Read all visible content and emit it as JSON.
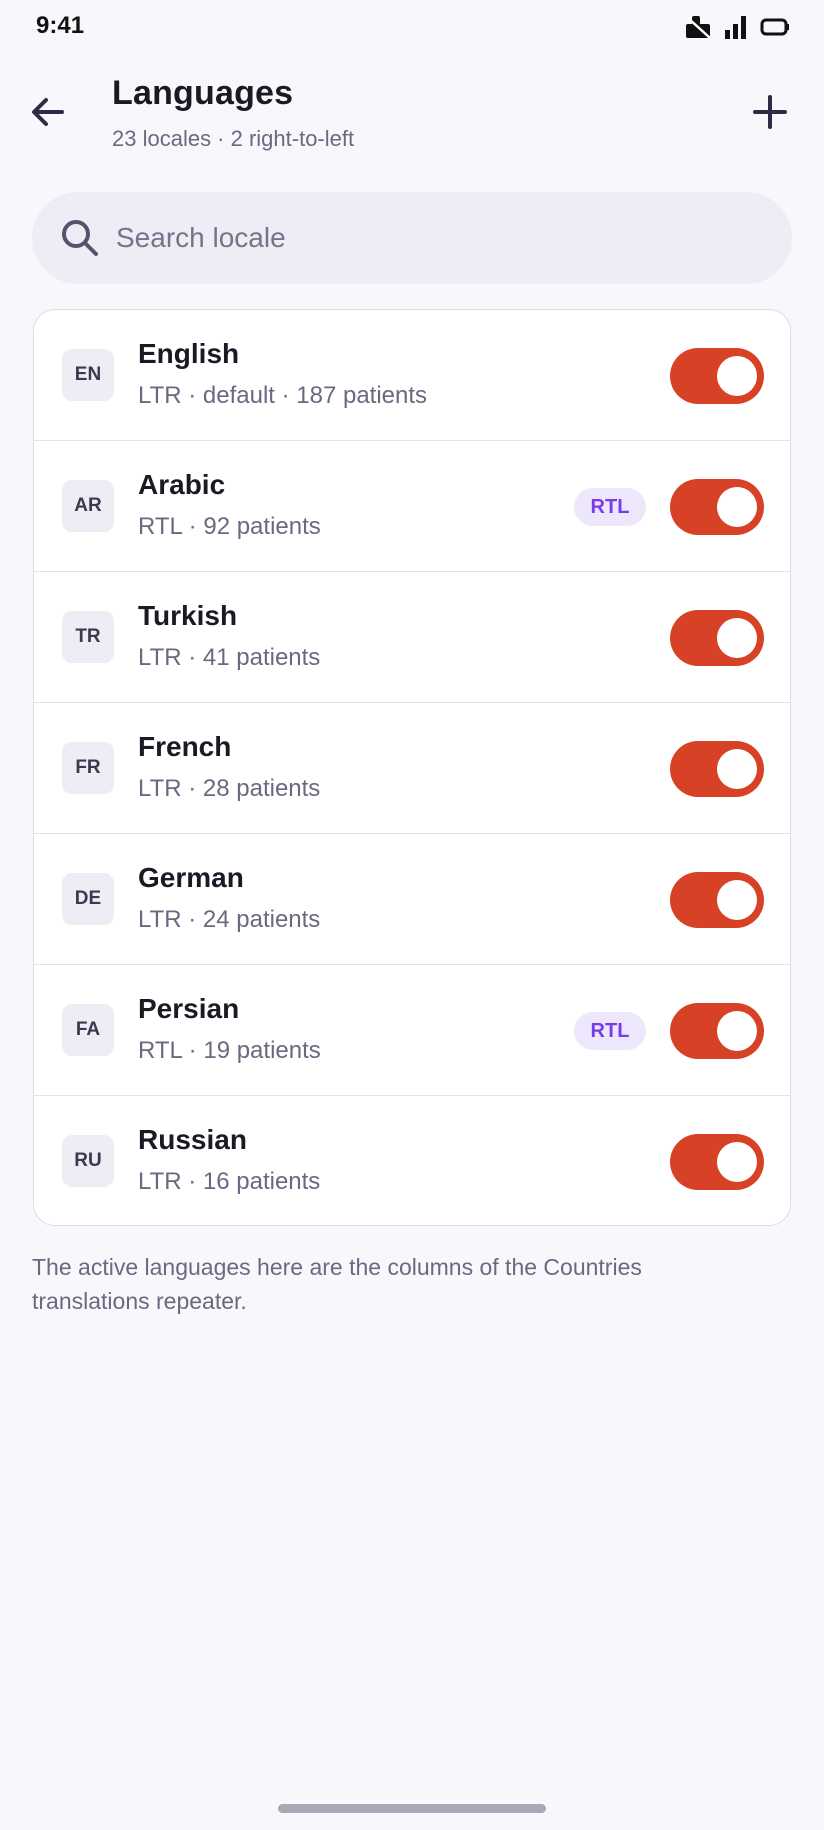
{
  "status_bar": {
    "time": "9:41",
    "icons": [
      "notification-icon",
      "signal-icon",
      "battery-icon"
    ]
  },
  "header": {
    "title": "Languages",
    "subtitle": "23 locales · 2 right-to-left",
    "back_icon": "arrow-left-icon",
    "add_icon": "plus-icon"
  },
  "search": {
    "placeholder": "Search locale",
    "value": ""
  },
  "languages": [
    {
      "code": "EN",
      "name": "English",
      "meta": "LTR · default · 187 patients",
      "rtl_badge": "",
      "enabled": true
    },
    {
      "code": "AR",
      "name": "Arabic",
      "meta": "RTL · 92 patients",
      "rtl_badge": "RTL",
      "enabled": true
    },
    {
      "code": "TR",
      "name": "Turkish",
      "meta": "LTR · 41 patients",
      "rtl_badge": "",
      "enabled": true
    },
    {
      "code": "FR",
      "name": "French",
      "meta": "LTR · 28 patients",
      "rtl_badge": "",
      "enabled": true
    },
    {
      "code": "DE",
      "name": "German",
      "meta": "LTR · 24 patients",
      "rtl_badge": "",
      "enabled": true
    },
    {
      "code": "FA",
      "name": "Persian",
      "meta": "RTL · 19 patients",
      "rtl_badge": "RTL",
      "enabled": true
    },
    {
      "code": "RU",
      "name": "Russian",
      "meta": "LTR · 16 patients",
      "rtl_badge": "",
      "enabled": true
    }
  ],
  "footnote": "The active languages here are the columns of the Countries translations repeater.",
  "colors": {
    "accent": "#d74125",
    "rtl_badge_text": "#7c3aed",
    "rtl_badge_bg": "#ece7fb",
    "background": "#f8f7fc"
  }
}
